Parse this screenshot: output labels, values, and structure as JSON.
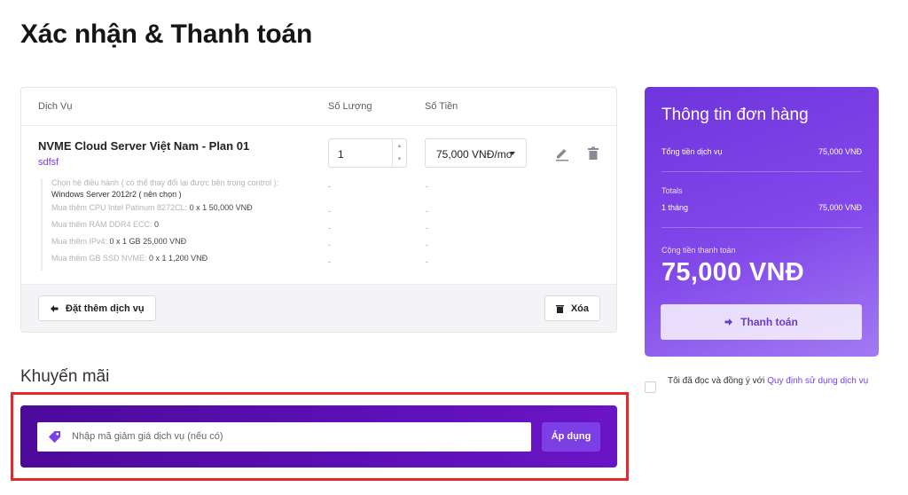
{
  "page": {
    "title": "Xác nhận & Thanh toán"
  },
  "cart": {
    "columns": {
      "service": "Dịch Vụ",
      "quantity": "Số Lượng",
      "price": "Số Tiền"
    },
    "product": {
      "name": "NVME Cloud Server Việt Nam - Plan 01",
      "subtitle": "sdfsf",
      "quantity": "1",
      "price_option": "75,000 VNĐ/mo"
    },
    "details": [
      {
        "label": "Chọn hệ điều hành ( có thể thay đổi lại được bên trong control ):",
        "value": "Windows Server 2012r2 ( nên chọn )",
        "qty": "-",
        "price": "-"
      },
      {
        "label": "Mua thêm CPU Intel Patinum 8272CL:",
        "value": "0 x 1 50,000 VNĐ",
        "qty": "-",
        "price": "-"
      },
      {
        "label": "Mua thêm RAM DDR4 ECC:",
        "value": "0",
        "qty": "-",
        "price": "-"
      },
      {
        "label": "Mua thêm IPv4:",
        "value": "0 x 1 GB 25,000 VNĐ",
        "qty": "-",
        "price": "-"
      },
      {
        "label": "Mua thêm GB SSD NVME:",
        "value": "0 x 1 1,200 VNĐ",
        "qty": "-",
        "price": "-"
      }
    ],
    "add_more_label": "Đặt thêm dịch vụ",
    "delete_label": "Xóa"
  },
  "promo": {
    "title": "Khuyến mãi",
    "placeholder": "Nhập mã giảm giá dịch vụ (nếu có)",
    "apply_label": "Áp dụng"
  },
  "summary": {
    "title": "Thông tin đơn hàng",
    "service_total_label": "Tổng tiền dịch vụ",
    "service_total_value": "75,000 VNĐ",
    "totals_label": "Totals",
    "period_label": "1 tháng",
    "period_value": "75,000 VNĐ",
    "grand_label": "Cộng tiền thanh toán",
    "grand_value": "75,000 VNĐ",
    "pay_label": "Thanh toán"
  },
  "agreement": {
    "text": "Tôi đã đọc và đồng ý với ",
    "link": "Quy định sử dụng dịch vụ"
  },
  "colors": {
    "accent": "#7b3fe4",
    "promo_bar": "#5d0fb8",
    "highlight_border": "#e4282b"
  },
  "icons": [
    "pencil-icon",
    "trash-icon",
    "arrow-left-icon",
    "tag-icon",
    "arrow-right-icon"
  ]
}
